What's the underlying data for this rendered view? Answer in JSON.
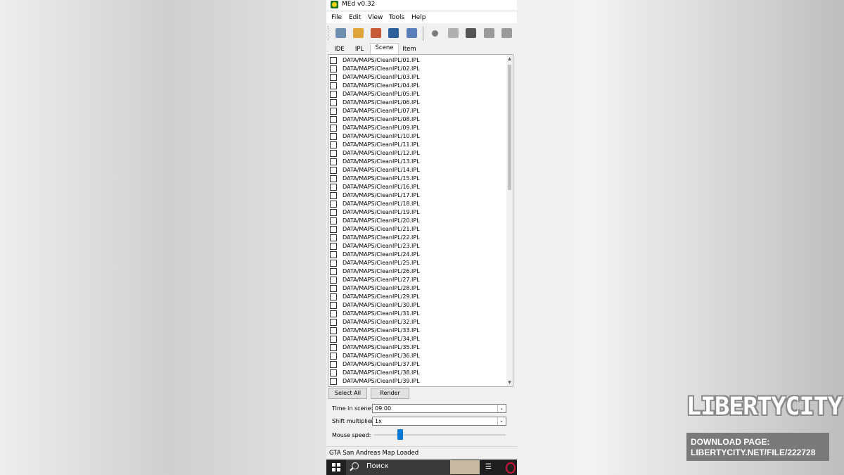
{
  "window": {
    "title": "MEd v0.32"
  },
  "menu": [
    "File",
    "Edit",
    "View",
    "Tools",
    "Help"
  ],
  "toolbar": {
    "buttons": [
      {
        "name": "home-icon",
        "color": "#6d8fb0"
      },
      {
        "name": "open-icon",
        "color": "#e0a53a"
      },
      {
        "name": "edit-icon",
        "color": "#c85a3a"
      },
      {
        "name": "image-icon",
        "color": "#2d5f9a"
      },
      {
        "name": "brush-icon",
        "color": "#5b7fb8"
      },
      {
        "name": "record-icon",
        "color": "#7a7a7a"
      },
      {
        "name": "page-icon",
        "color": "#b0b0b0"
      },
      {
        "name": "move-icon",
        "color": "#555555"
      },
      {
        "name": "undo-icon",
        "color": "#9a9a9a"
      },
      {
        "name": "redo-icon",
        "color": "#9a9a9a"
      }
    ]
  },
  "tabs": [
    "IDE",
    "IPL",
    "Scene",
    "Item"
  ],
  "active_tab": "Scene",
  "scene_items": [
    "DATA/MAPS/CleanIPL/01.IPL",
    "DATA/MAPS/CleanIPL/02.IPL",
    "DATA/MAPS/CleanIPL/03.IPL",
    "DATA/MAPS/CleanIPL/04.IPL",
    "DATA/MAPS/CleanIPL/05.IPL",
    "DATA/MAPS/CleanIPL/06.IPL",
    "DATA/MAPS/CleanIPL/07.IPL",
    "DATA/MAPS/CleanIPL/08.IPL",
    "DATA/MAPS/CleanIPL/09.IPL",
    "DATA/MAPS/CleanIPL/10.IPL",
    "DATA/MAPS/CleanIPL/11.IPL",
    "DATA/MAPS/CleanIPL/12.IPL",
    "DATA/MAPS/CleanIPL/13.IPL",
    "DATA/MAPS/CleanIPL/14.IPL",
    "DATA/MAPS/CleanIPL/15.IPL",
    "DATA/MAPS/CleanIPL/16.IPL",
    "DATA/MAPS/CleanIPL/17.IPL",
    "DATA/MAPS/CleanIPL/18.IPL",
    "DATA/MAPS/CleanIPL/19.IPL",
    "DATA/MAPS/CleanIPL/20.IPL",
    "DATA/MAPS/CleanIPL/21.IPL",
    "DATA/MAPS/CleanIPL/22.IPL",
    "DATA/MAPS/CleanIPL/23.IPL",
    "DATA/MAPS/CleanIPL/24.IPL",
    "DATA/MAPS/CleanIPL/25.IPL",
    "DATA/MAPS/CleanIPL/26.IPL",
    "DATA/MAPS/CleanIPL/27.IPL",
    "DATA/MAPS/CleanIPL/28.IPL",
    "DATA/MAPS/CleanIPL/29.IPL",
    "DATA/MAPS/CleanIPL/30.IPL",
    "DATA/MAPS/CleanIPL/31.IPL",
    "DATA/MAPS/CleanIPL/32.IPL",
    "DATA/MAPS/CleanIPL/33.IPL",
    "DATA/MAPS/CleanIPL/34.IPL",
    "DATA/MAPS/CleanIPL/35.IPL",
    "DATA/MAPS/CleanIPL/36.IPL",
    "DATA/MAPS/CleanIPL/37.IPL",
    "DATA/MAPS/CleanIPL/38.IPL",
    "DATA/MAPS/CleanIPL/39.IPL"
  ],
  "buttons": {
    "select_all": "Select All",
    "render": "Render"
  },
  "fields": {
    "time_label": "Time in scene:",
    "time_value": "09:00",
    "shift_label": "Shift multiplier:",
    "shift_value": "1x",
    "mouse_label": "Mouse speed:",
    "mouse_speed_fraction": 0.2
  },
  "status": "GTA San Andreas Map Loaded",
  "taskbar": {
    "search_placeholder": "Поиск"
  },
  "watermark": {
    "logo": "LIBERTYCITY",
    "line1": "DOWNLOAD PAGE:",
    "line2": "LIBERTYCITY.NET/FILE/222728"
  },
  "colors": {
    "accent": "#0078d7",
    "window_bg": "#f0f0f0",
    "taskbar_bg": "#1f1f1f"
  }
}
